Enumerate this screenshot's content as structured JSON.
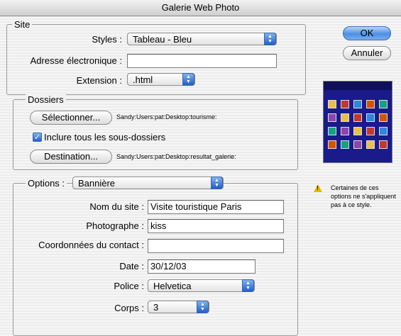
{
  "window": {
    "title": "Galerie Web Photo"
  },
  "site": {
    "legend": "Site",
    "styles_label": "Styles :",
    "styles_value": "Tableau - Bleu",
    "email_label": "Adresse électronique :",
    "email_value": "",
    "extension_label": "Extension :",
    "extension_value": ".html"
  },
  "buttons": {
    "ok": "OK",
    "cancel": "Annuler"
  },
  "folders": {
    "legend": "Dossiers",
    "select_label": "Sélectionner...",
    "source_path": "Sandy:Users:pat:Desktop:tourisme:",
    "include_subfolders_label": "Inclure tous les sous-dossiers",
    "include_subfolders_checked": true,
    "destination_label": "Destination...",
    "destination_path": "Sandy:Users:pat:Desktop:resultat_galerie:"
  },
  "options": {
    "label": "Options :",
    "value": "Bannière",
    "site_name_label": "Nom du site :",
    "site_name_value": "Visite touristique Paris",
    "photographer_label": "Photographe :",
    "photographer_value": "kiss",
    "contact_label": "Coordonnées du contact :",
    "contact_value": "",
    "date_label": "Date :",
    "date_value": "30/12/03",
    "font_label": "Police :",
    "font_value": "Helvetica",
    "size_label": "Corps :",
    "size_value": "3"
  },
  "warning": {
    "icon": "warning-icon",
    "text": "Certaines de ces options ne s'appliquent pas à ce style."
  },
  "colors": {
    "accent": "#4d8fe3",
    "preview_bg": "#1a1a8a"
  }
}
